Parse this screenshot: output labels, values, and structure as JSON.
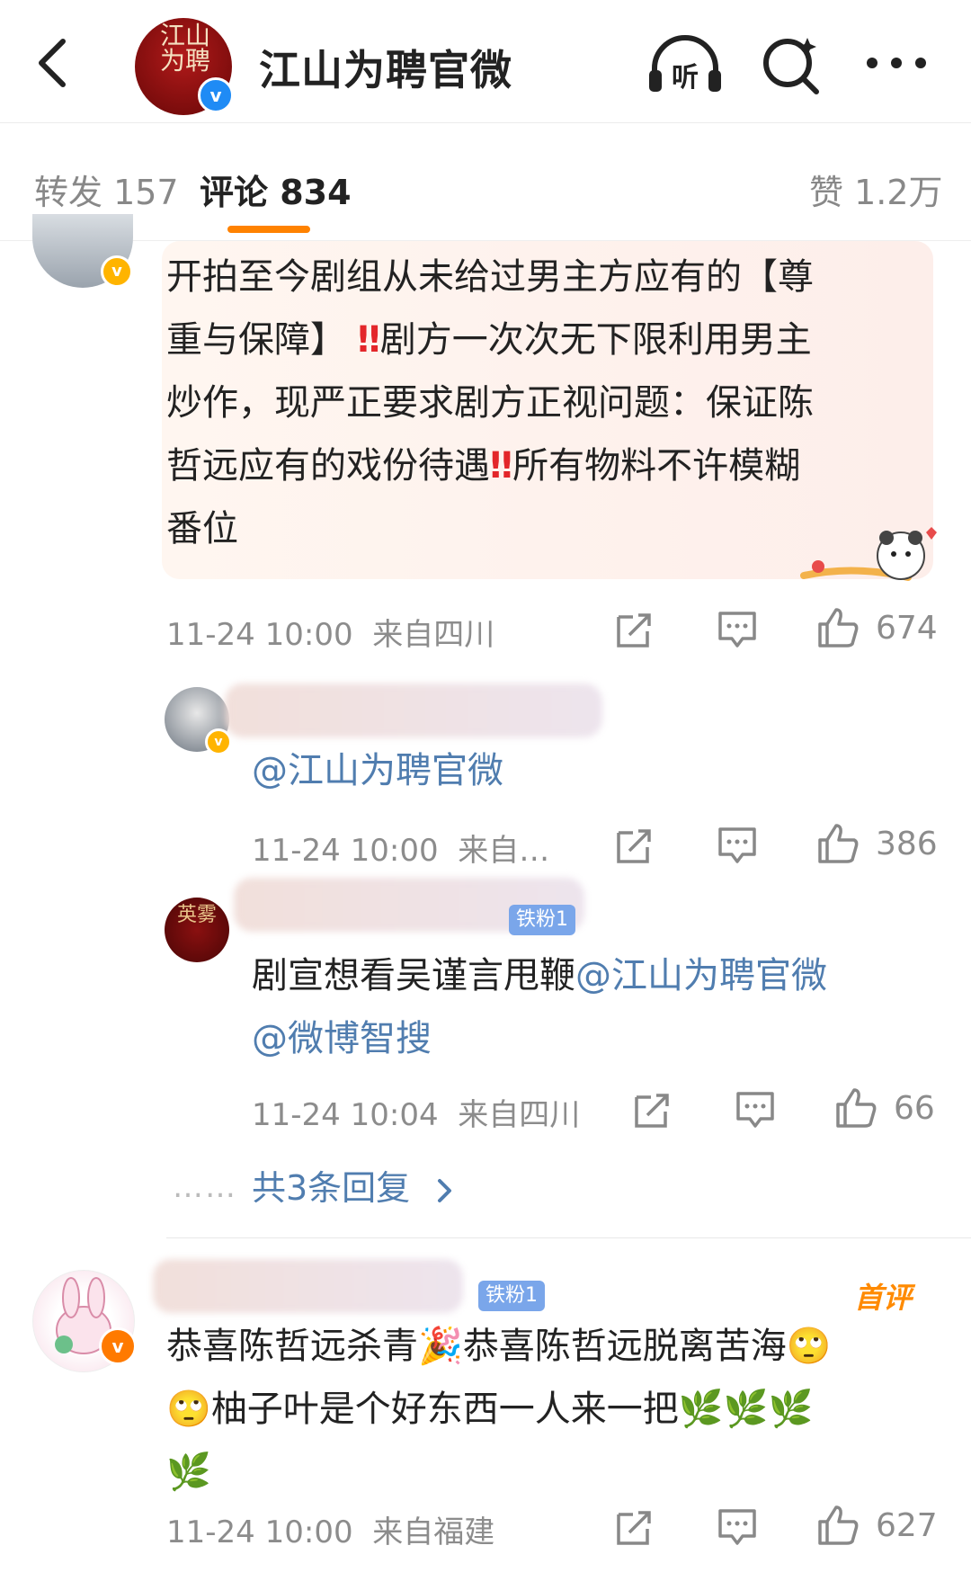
{
  "header": {
    "title": "江山为聘官微",
    "avatar_text": "江山为聘",
    "verified_mark": "v"
  },
  "tabs": {
    "repost": "转发 157",
    "comment": "评论 834",
    "like": "赞 1.2万"
  },
  "comments": [
    {
      "text_1": "开拍至今剧组从未给过男主方应有的【尊",
      "text_2": "重与保障】",
      "text_2b": "剧方一次次无下限利用男主",
      "text_3": "炒作，现严正要求剧方正视问题：保证陈",
      "text_4": "哲远应有的戏份待遇",
      "text_4b": "所有物料不许模糊",
      "text_5": "番位",
      "emphasis": "‼",
      "time": "11-24 10:00",
      "location": "来自四川",
      "likes": "674",
      "badge_mark": "v"
    },
    {
      "mention": "@江山为聘官微",
      "time": "11-24 10:00",
      "location": "来自…",
      "likes": "386",
      "badge_mark": "v"
    },
    {
      "fan_badge": "铁粉1",
      "text": "剧宣想看吴谨言甩鞭",
      "mention_1": "@江山为聘官微",
      "mention_2": "@微博智搜",
      "avatar_text": "英雾",
      "time": "11-24 10:04",
      "location": "来自四川",
      "likes": "66"
    },
    {
      "replies": "共3条回复",
      "dots": "……"
    },
    {
      "fan_badge": "铁粉1",
      "first_badge": "首评",
      "line_1": "恭喜陈哲远杀青",
      "line_1b": "恭喜陈哲远脱离苦海",
      "line_2": "柚子叶是个好东西一人来一把",
      "party_emoji": "🎉",
      "eye_emoji": "🙄",
      "leaf_emoji": "🌿",
      "time": "11-24 10:00",
      "location": "来自福建",
      "likes": "627",
      "badge_mark": "v"
    }
  ],
  "colors": {
    "accent": "#ff8200",
    "mention": "#507daf",
    "verify_blue": "#1f8bf5",
    "verify_gold": "#ffb400"
  },
  "icons": [
    "back-icon",
    "listen-icon",
    "search-icon",
    "more-icon",
    "share-icon",
    "comment-icon",
    "like-icon",
    "chevron-right-icon"
  ]
}
